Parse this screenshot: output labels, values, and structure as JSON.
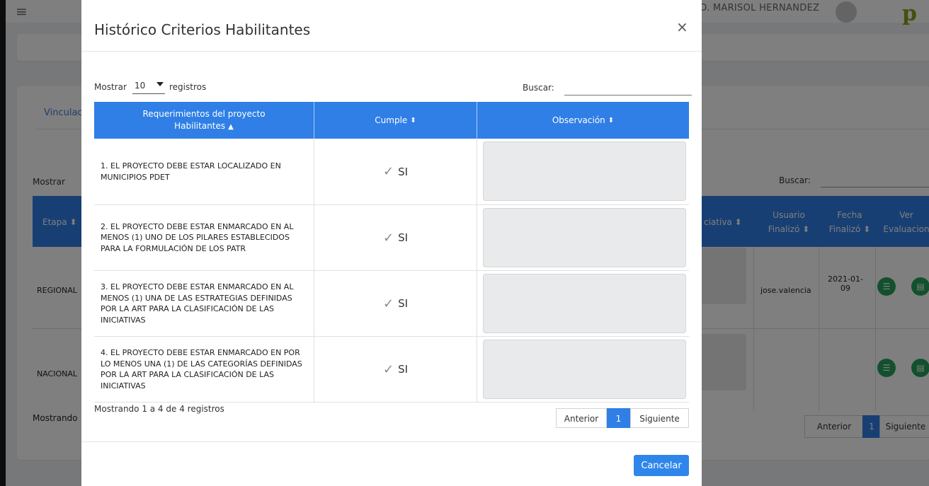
{
  "background": {
    "user_name": "O. MARISOL HERNANDEZ",
    "tab_label": "Vinculac",
    "show_label": "Mostrar",
    "search_label": "Buscar:",
    "headers": {
      "etapa": "Etapa",
      "iniciativa": "ciativa",
      "usuario_line1": "Usuario",
      "usuario_line2": "Finalizó",
      "fecha_line1": "Fecha",
      "fecha_line2": "Finalizó",
      "ver_line1": "Ver",
      "ver_line2": "Evaluacion"
    },
    "rows": [
      {
        "etapa": "REGIONAL",
        "usuario": "jose.valencia",
        "fecha_line1": "2021-01-",
        "fecha_line2": "09"
      },
      {
        "etapa": "NACIONAL",
        "usuario": "",
        "fecha_line1": "",
        "fecha_line2": ""
      }
    ],
    "info": "Mostrando",
    "pager": {
      "prev": "Anterior",
      "page": "1",
      "next": "Siguiente"
    }
  },
  "modal": {
    "title": "Histórico Criterios Habilitantes",
    "close_symbol": "×",
    "length_prefix": "Mostrar",
    "length_value": "10",
    "length_suffix": "registros",
    "search_label": "Buscar:",
    "search_value": "",
    "columns": {
      "req_line1": "Requerimientos del proyecto",
      "req_line2": "Habilitantes",
      "cumple": "Cumple",
      "observacion": "Observación"
    },
    "rows": [
      {
        "requirement": "1. EL PROYECTO DEBE ESTAR LOCALIZADO EN MUNICIPIOS PDET",
        "cumple": "SI",
        "observacion": ""
      },
      {
        "requirement": "2. EL PROYECTO DEBE ESTAR ENMARCADO EN AL MENOS (1) UNO DE LOS PILARES ESTABLECIDOS PARA LA FORMULACIÓN DE LOS PATR",
        "cumple": "SI",
        "observacion": ""
      },
      {
        "requirement": "3. EL PROYECTO DEBE ESTAR ENMARCADO EN AL MENOS (1) UNA DE LAS ESTRATEGIAS DEFINIDAS POR LA ART PARA LA CLASIFICACIÓN DE LAS INICIATIVAS",
        "cumple": "SI",
        "observacion": ""
      },
      {
        "requirement": "4. EL PROYECTO DEBE ESTAR ENMARCADO EN POR LO MENOS UNA (1) DE LAS CATEGORÍAS DEFINIDAS POR LA ART PARA LA CLASIFICACIÓN DE LAS INICIATIVAS",
        "cumple": "SI",
        "observacion": ""
      }
    ],
    "info": "Mostrando 1 a 4 de 4 registros",
    "pager": {
      "prev": "Anterior",
      "page": "1",
      "next": "Siguiente"
    },
    "cancel_label": "Cancelar"
  },
  "icons": {
    "check": "✓",
    "sort_both": "⬍",
    "sort_asc": "▲",
    "menu": "≡",
    "list": "☰",
    "card": "▤"
  },
  "colors": {
    "primary": "#2f7fe6",
    "success": "#26a05a",
    "overlay": "rgba(0,0,0,0.5)"
  }
}
